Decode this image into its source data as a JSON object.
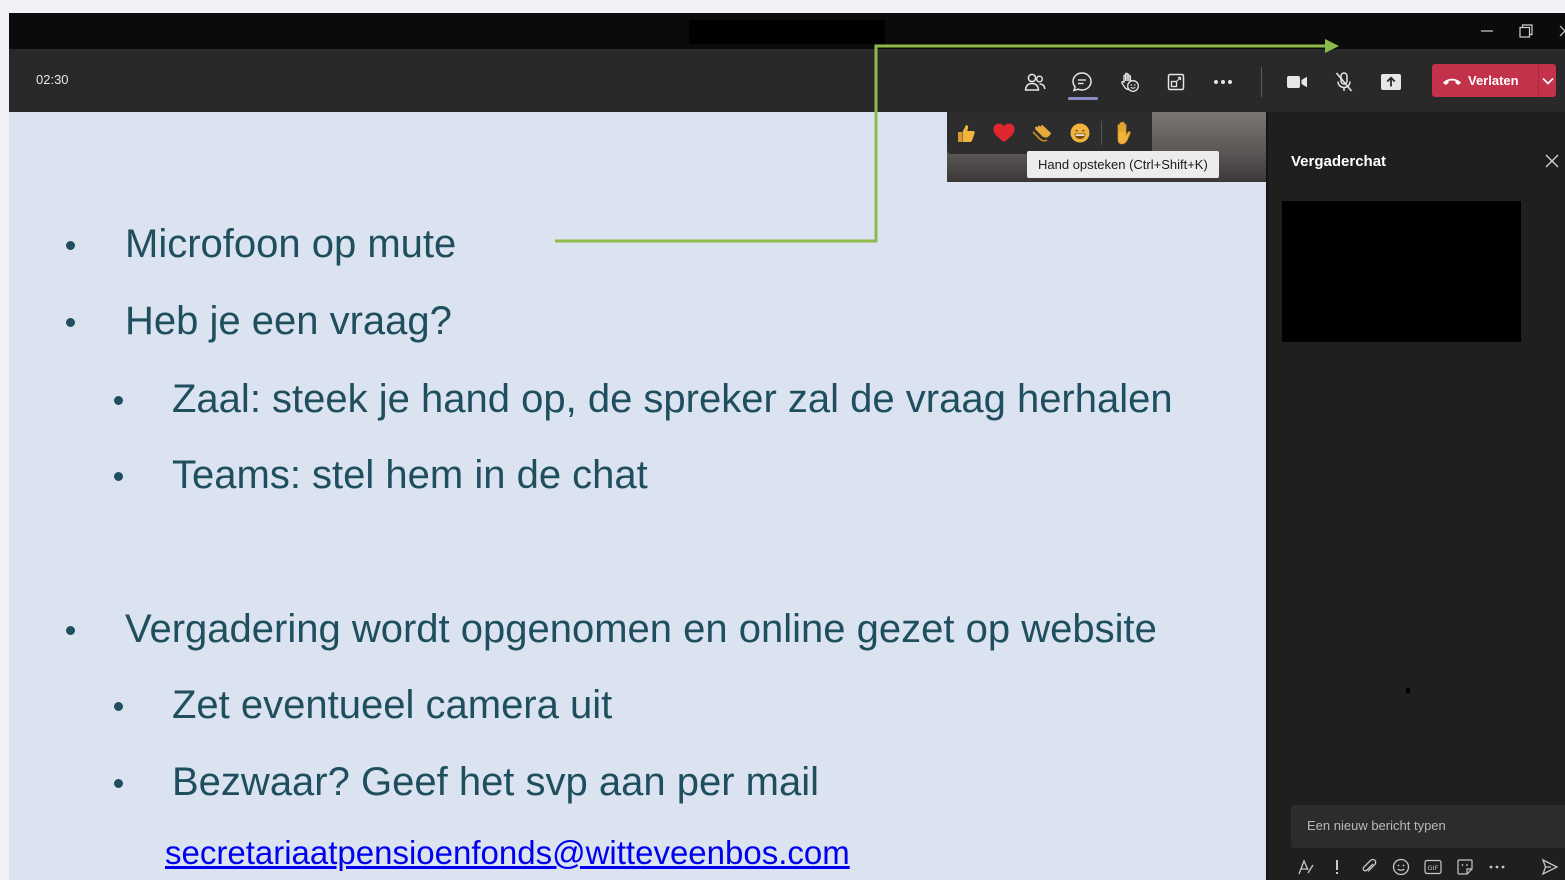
{
  "window": {
    "minimize_glyph": "—",
    "restore_glyph": "❐",
    "close_glyph": "✕"
  },
  "toolbar": {
    "timer": "02:30",
    "icons": [
      "participants-icon",
      "chat-icon",
      "reactions-icon",
      "view-icon",
      "more-icon",
      "camera-icon",
      "mic-muted-icon",
      "share-icon"
    ],
    "leave_label": "Verlaten",
    "leave_color": "#c4314b"
  },
  "reactions": {
    "items": [
      "thumbs-up",
      "heart",
      "clap",
      "laugh",
      "raise-hand"
    ],
    "tooltip": "Hand opsteken (Ctrl+Shift+K)"
  },
  "slide": {
    "background": "#dae3ef",
    "text_color": "#1f4e5f",
    "bullets": [
      {
        "level": 1,
        "text": "Microfoon op mute"
      },
      {
        "level": 1,
        "text": "Heb je een vraag?"
      },
      {
        "level": 2,
        "text": "Zaal: steek je hand op, de spreker zal de vraag herhalen"
      },
      {
        "level": 2,
        "text": "Teams: stel hem in de chat"
      },
      {
        "level": 1,
        "text": "Vergadering wordt opgenomen en online gezet op website"
      },
      {
        "level": 2,
        "text": "Zet eventueel camera uit"
      },
      {
        "level": 2,
        "text": "Bezwaar? Geef het svp aan per mail"
      }
    ],
    "email": "secretariaatpensioenfonds@witteveenbos.com",
    "annotation_color": "#8dbb4a"
  },
  "chat_panel": {
    "title": "Vergaderchat",
    "compose_placeholder": "Een nieuw bericht typen",
    "compose_tools": [
      "format-icon",
      "important-icon",
      "attach-icon",
      "emoji-icon",
      "gif-icon",
      "sticker-icon",
      "more-options-icon",
      "send-icon"
    ],
    "gif_label": "GIF"
  }
}
